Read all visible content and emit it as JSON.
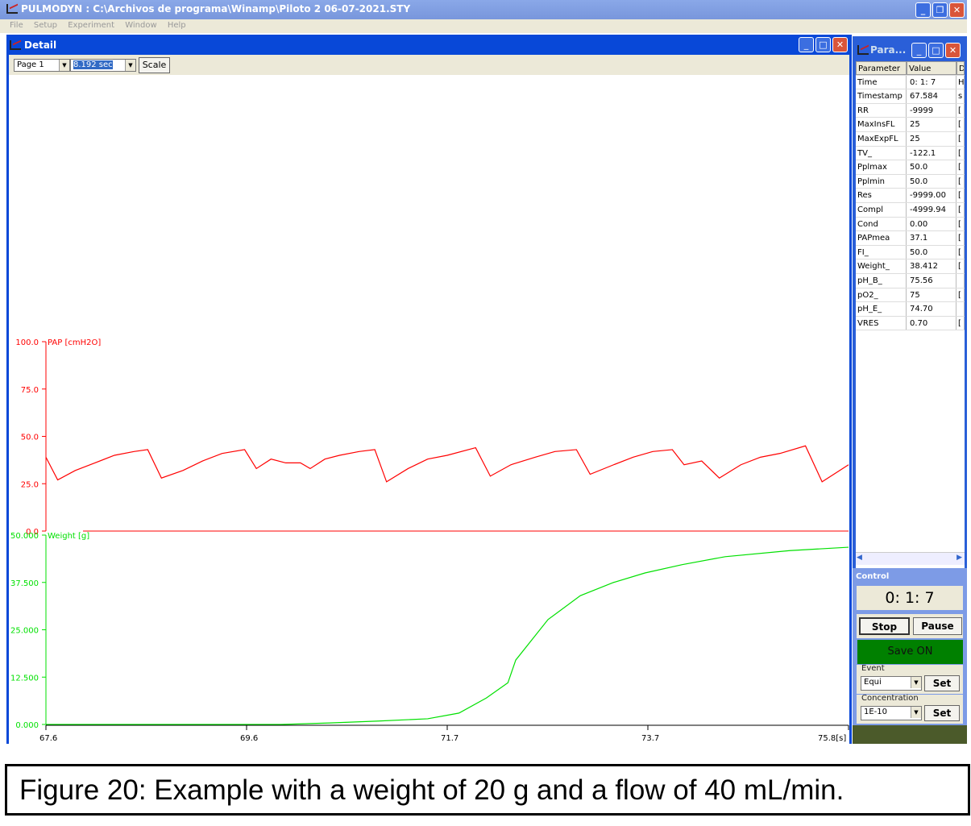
{
  "app": {
    "title": "PULMODYN : C:\\Archivos de programa\\Winamp\\Piloto 2 06-07-2021.STY",
    "menu": [
      "File",
      "Setup",
      "Experiment",
      "Window",
      "Help"
    ]
  },
  "detail": {
    "title": "Detail",
    "page": "Page 1",
    "span": "8.192 sec",
    "scale_label": "Scale"
  },
  "param": {
    "title": "Para...",
    "headers": [
      "Parameter",
      "Value",
      "D"
    ],
    "rows": [
      [
        "Time",
        "0: 1: 7",
        "H"
      ],
      [
        "Timestamp",
        "67.584",
        "s"
      ],
      [
        "RR",
        "-9999",
        "["
      ],
      [
        "MaxInsFL",
        "25",
        "["
      ],
      [
        "MaxExpFL",
        "25",
        "["
      ],
      [
        "TV_",
        "-122.1",
        "["
      ],
      [
        "Pplmax",
        "50.0",
        "["
      ],
      [
        "Pplmin",
        "50.0",
        "["
      ],
      [
        "Res",
        "-9999.00",
        "["
      ],
      [
        "Compl",
        "-4999.94",
        "["
      ],
      [
        "Cond",
        "0.00",
        "["
      ],
      [
        "PAPmea",
        "37.1",
        "["
      ],
      [
        "FI_",
        "50.0",
        "["
      ],
      [
        "Weight_",
        "38.412",
        "["
      ],
      [
        "pH_B_",
        "75.56",
        ""
      ],
      [
        "pO2_",
        "75",
        "["
      ],
      [
        "pH_E_",
        "74.70",
        ""
      ],
      [
        "VRES",
        "0.70",
        "["
      ]
    ]
  },
  "control": {
    "title": "Control",
    "clock": "0: 1: 7",
    "stop": "Stop",
    "pause": "Pause",
    "save": "Save ON",
    "event_label": "Event",
    "event_value": "Equi",
    "concentration_label": "Concentration",
    "concentration_value": "1E-10",
    "set": "Set"
  },
  "colors": {
    "pap": "#ff0000",
    "weight": "#00e000",
    "save_on": "#008000"
  },
  "chart_data": {
    "type": "line",
    "x_ticks": [
      "67.6",
      "69.6",
      "71.7",
      "73.7",
      "75.8[s]"
    ],
    "xlim": [
      67.6,
      75.8
    ],
    "series": [
      {
        "name": "PAP [cmH2O]",
        "ylim": [
          0,
          100
        ],
        "y_ticks": [
          "100.0",
          "75.0",
          "50.0",
          "25.0",
          "0.0"
        ],
        "points": [
          [
            67.6,
            39
          ],
          [
            67.72,
            27
          ],
          [
            67.9,
            32
          ],
          [
            68.1,
            36
          ],
          [
            68.3,
            40
          ],
          [
            68.5,
            42
          ],
          [
            68.64,
            43
          ],
          [
            68.78,
            28
          ],
          [
            69.0,
            32
          ],
          [
            69.2,
            37
          ],
          [
            69.4,
            41
          ],
          [
            69.63,
            43
          ],
          [
            69.75,
            33
          ],
          [
            69.9,
            38
          ],
          [
            70.05,
            36
          ],
          [
            70.2,
            36
          ],
          [
            70.3,
            33
          ],
          [
            70.45,
            38
          ],
          [
            70.6,
            40
          ],
          [
            70.8,
            42
          ],
          [
            70.96,
            43
          ],
          [
            71.08,
            26
          ],
          [
            71.3,
            33
          ],
          [
            71.5,
            38
          ],
          [
            71.7,
            40
          ],
          [
            71.99,
            44
          ],
          [
            72.14,
            29
          ],
          [
            72.35,
            35
          ],
          [
            72.6,
            39
          ],
          [
            72.8,
            42
          ],
          [
            73.02,
            43
          ],
          [
            73.16,
            30
          ],
          [
            73.4,
            35
          ],
          [
            73.6,
            39
          ],
          [
            73.8,
            42
          ],
          [
            74.0,
            43
          ],
          [
            74.12,
            35
          ],
          [
            74.3,
            37
          ],
          [
            74.48,
            28
          ],
          [
            74.7,
            35
          ],
          [
            74.9,
            39
          ],
          [
            75.1,
            41
          ],
          [
            75.36,
            45
          ],
          [
            75.53,
            26
          ],
          [
            75.8,
            35
          ]
        ]
      },
      {
        "name": "Weight [g]",
        "ylim": [
          0,
          50
        ],
        "y_ticks": [
          "50.000",
          "37.500",
          "25.000",
          "12.500",
          "0.000"
        ],
        "points": [
          [
            67.6,
            0
          ],
          [
            70.0,
            0
          ],
          [
            70.5,
            0.4
          ],
          [
            71.0,
            0.9
          ],
          [
            71.5,
            1.5
          ],
          [
            71.82,
            3
          ],
          [
            72.1,
            7
          ],
          [
            72.32,
            11
          ],
          [
            72.4,
            17
          ],
          [
            72.73,
            27.7
          ],
          [
            73.06,
            34
          ],
          [
            73.4,
            37.5
          ],
          [
            73.72,
            40
          ],
          [
            74.1,
            42.2
          ],
          [
            74.54,
            44.3
          ],
          [
            75.2,
            45.9
          ],
          [
            75.8,
            46.8
          ]
        ]
      }
    ]
  }
}
